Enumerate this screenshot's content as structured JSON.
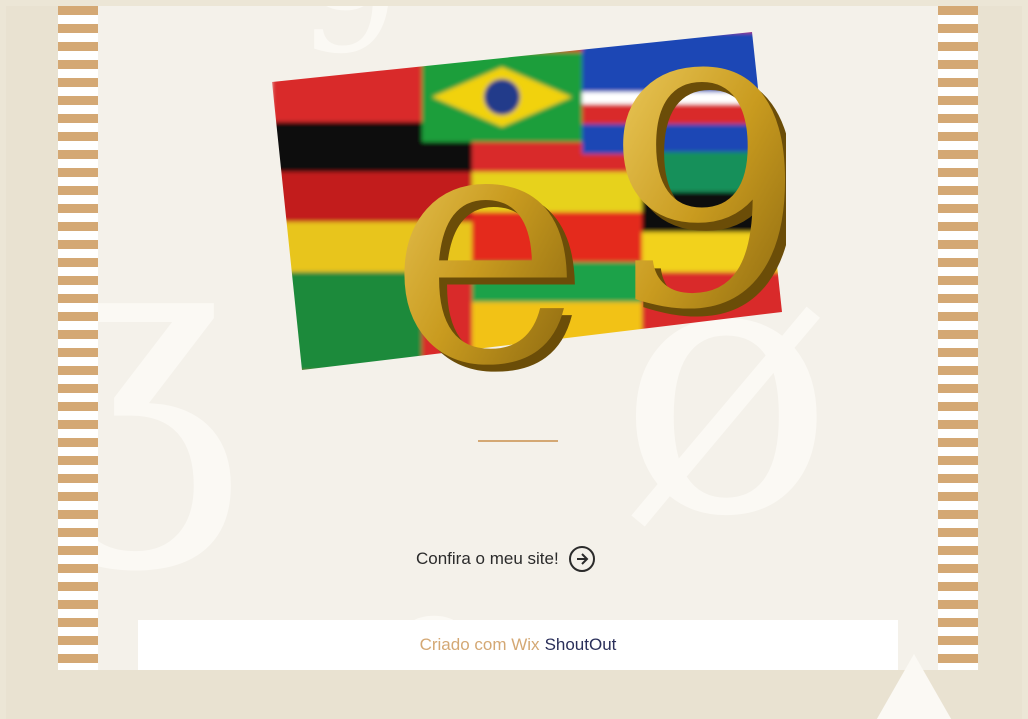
{
  "cta": {
    "label": "Confira o meu site!",
    "icon": "arrow-right-circle-icon"
  },
  "footer": {
    "created_with": "Criado com Wix",
    "brand": "ShoutOut"
  },
  "logo": {
    "text": "e9",
    "description_icon": "e9-logo-with-flags"
  },
  "colors": {
    "accent": "#d4a874",
    "panel": "#f4f1ea",
    "background": "#e9e2d1",
    "brand_text": "#2a2f5a"
  }
}
